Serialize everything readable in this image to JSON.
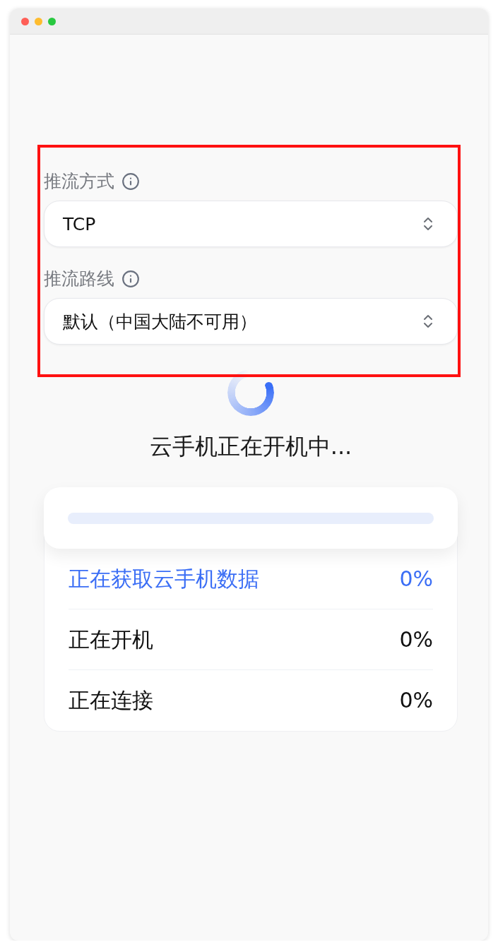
{
  "settings": [
    {
      "label": "推流方式",
      "value": "TCP"
    },
    {
      "label": "推流路线",
      "value": "默认（中国大陆不可用）"
    }
  ],
  "status": {
    "title": "云手机正在开机中..."
  },
  "steps": [
    {
      "label": "正在获取云手机数据",
      "percent": "0%",
      "active": true
    },
    {
      "label": "正在开机",
      "percent": "0%",
      "active": false
    },
    {
      "label": "正在连接",
      "percent": "0%",
      "active": false
    }
  ]
}
